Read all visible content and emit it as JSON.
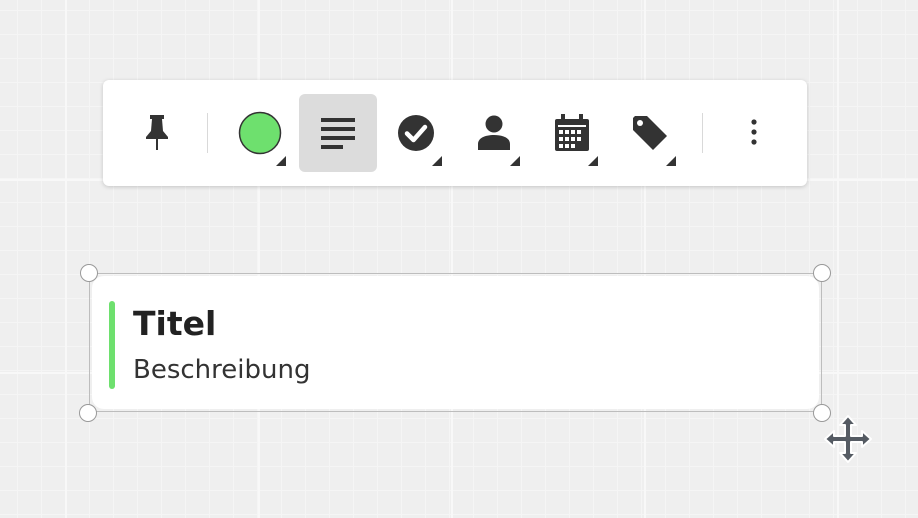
{
  "toolbar": {
    "tools": [
      {
        "name": "pin-button",
        "icon": "pin-icon",
        "has_dropdown": false,
        "active": false
      },
      {
        "name": "color-button",
        "icon": "color-circle-icon",
        "has_dropdown": true,
        "active": false
      },
      {
        "name": "description-button",
        "icon": "text-lines-icon",
        "has_dropdown": false,
        "active": true
      },
      {
        "name": "status-button",
        "icon": "check-circle-icon",
        "has_dropdown": true,
        "active": false
      },
      {
        "name": "assignee-button",
        "icon": "person-icon",
        "has_dropdown": true,
        "active": false
      },
      {
        "name": "date-button",
        "icon": "calendar-icon",
        "has_dropdown": true,
        "active": false
      },
      {
        "name": "tag-button",
        "icon": "tag-icon",
        "has_dropdown": true,
        "active": false
      },
      {
        "name": "more-button",
        "icon": "more-vertical-icon",
        "has_dropdown": false,
        "active": false
      }
    ],
    "selected_color": "#6ee06e"
  },
  "card": {
    "title": "Titel",
    "description": "Beschreibung",
    "accent_color": "#6ee06e"
  },
  "colors": {
    "icon": "#333333",
    "active_tool_bg": "#dcdcdc"
  }
}
